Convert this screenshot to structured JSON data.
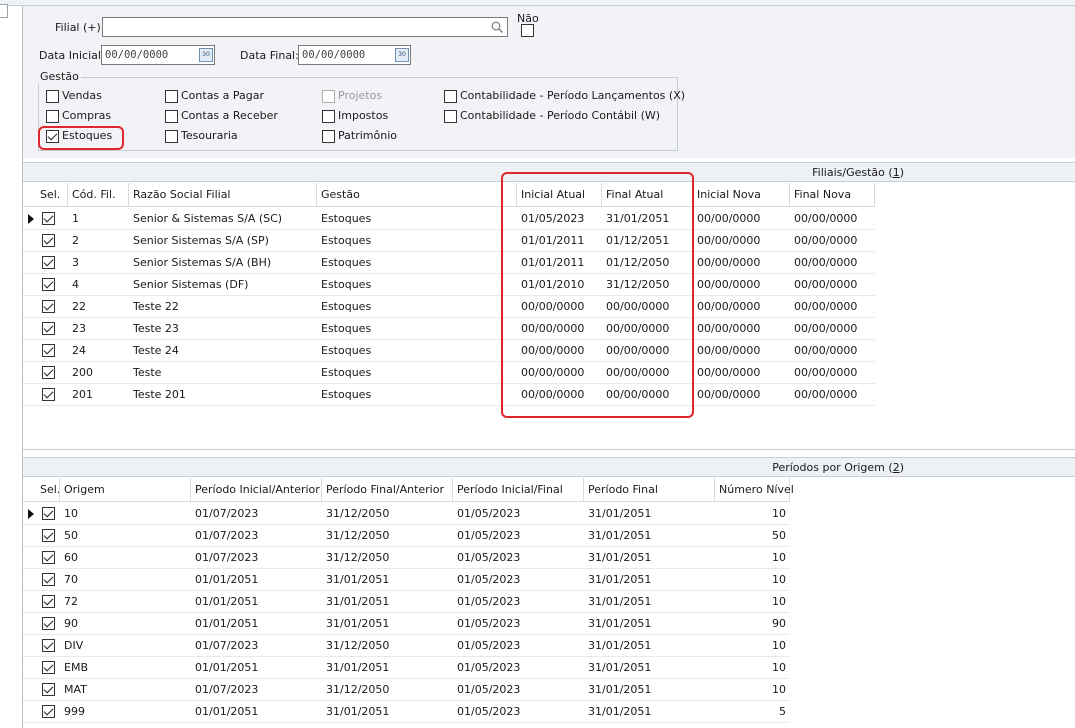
{
  "filters": {
    "filial_label": "Filial (+):",
    "filial_value": "",
    "nao_label": "Não",
    "data_inicial_label": "Data Inicial:",
    "data_inicial_value": "00/00/0000",
    "data_final_label": "Data Final:",
    "data_final_value": "00/00/0000",
    "gestao_label": "Gestão",
    "options": {
      "vendas": "Vendas",
      "compras": "Compras",
      "estoques": "Estoques",
      "contas_pagar": "Contas a Pagar",
      "contas_receber": "Contas a Receber",
      "tesouraria": "Tesouraria",
      "projetos": "Projetos",
      "impostos": "Impostos",
      "patrimonio": "Patrimônio",
      "cont_lanc": "Contabilidade - Período Lançamentos (X)",
      "cont_contabil": "Contabilidade - Período Contábil (W)"
    }
  },
  "filiais": {
    "title": "Filiais/Gestão",
    "title_num": "1",
    "headers": [
      "Sel.",
      "Cód. Fil.",
      "Razão Social Filial",
      "Gestão",
      "Inicial Atual",
      "Final Atual",
      "Inicial Nova",
      "Final Nova"
    ],
    "rows": [
      [
        "1",
        "Senior & Sistemas S/A (SC)",
        "Estoques",
        "01/05/2023",
        "31/01/2051",
        "00/00/0000",
        "00/00/0000"
      ],
      [
        "2",
        "Senior Sistemas S/A (SP)",
        "Estoques",
        "01/01/2011",
        "01/12/2051",
        "00/00/0000",
        "00/00/0000"
      ],
      [
        "3",
        "Senior Sistemas S/A (BH)",
        "Estoques",
        "01/01/2011",
        "01/12/2050",
        "00/00/0000",
        "00/00/0000"
      ],
      [
        "4",
        "Senior Sistemas (DF)",
        "Estoques",
        "01/01/2010",
        "31/12/2050",
        "00/00/0000",
        "00/00/0000"
      ],
      [
        "22",
        "Teste 22",
        "Estoques",
        "00/00/0000",
        "00/00/0000",
        "00/00/0000",
        "00/00/0000"
      ],
      [
        "23",
        "Teste 23",
        "Estoques",
        "00/00/0000",
        "00/00/0000",
        "00/00/0000",
        "00/00/0000"
      ],
      [
        "24",
        "Teste 24",
        "Estoques",
        "00/00/0000",
        "00/00/0000",
        "00/00/0000",
        "00/00/0000"
      ],
      [
        "200",
        "Teste",
        "Estoques",
        "00/00/0000",
        "00/00/0000",
        "00/00/0000",
        "00/00/0000"
      ],
      [
        "201",
        "Teste 201",
        "Estoques",
        "00/00/0000",
        "00/00/0000",
        "00/00/0000",
        "00/00/0000"
      ]
    ]
  },
  "periodos": {
    "title": "Períodos por Origem",
    "title_num": "2",
    "headers": [
      "Sel.",
      "Origem",
      "Período Inicial/Anterior",
      "Período Final/Anterior",
      "Período Inicial/Final",
      "Período Final",
      "Número Nível"
    ],
    "rows": [
      [
        "10",
        "01/07/2023",
        "31/12/2050",
        "01/05/2023",
        "31/01/2051",
        "10"
      ],
      [
        "50",
        "01/07/2023",
        "31/12/2050",
        "01/05/2023",
        "31/01/2051",
        "50"
      ],
      [
        "60",
        "01/07/2023",
        "31/12/2050",
        "01/05/2023",
        "31/01/2051",
        "10"
      ],
      [
        "70",
        "01/01/2051",
        "31/01/2051",
        "01/05/2023",
        "31/01/2051",
        "10"
      ],
      [
        "72",
        "01/01/2051",
        "31/01/2051",
        "01/05/2023",
        "31/01/2051",
        "10"
      ],
      [
        "90",
        "01/01/2051",
        "31/01/2051",
        "01/05/2023",
        "31/01/2051",
        "90"
      ],
      [
        "DIV",
        "01/07/2023",
        "31/12/2050",
        "01/05/2023",
        "31/01/2051",
        "10"
      ],
      [
        "EMB",
        "01/01/2051",
        "31/01/2051",
        "01/05/2023",
        "31/01/2051",
        "10"
      ],
      [
        "MAT",
        "01/07/2023",
        "31/12/2050",
        "01/05/2023",
        "31/01/2051",
        "10"
      ],
      [
        "999",
        "01/01/2051",
        "31/01/2051",
        "01/05/2023",
        "31/01/2051",
        "5"
      ]
    ]
  }
}
